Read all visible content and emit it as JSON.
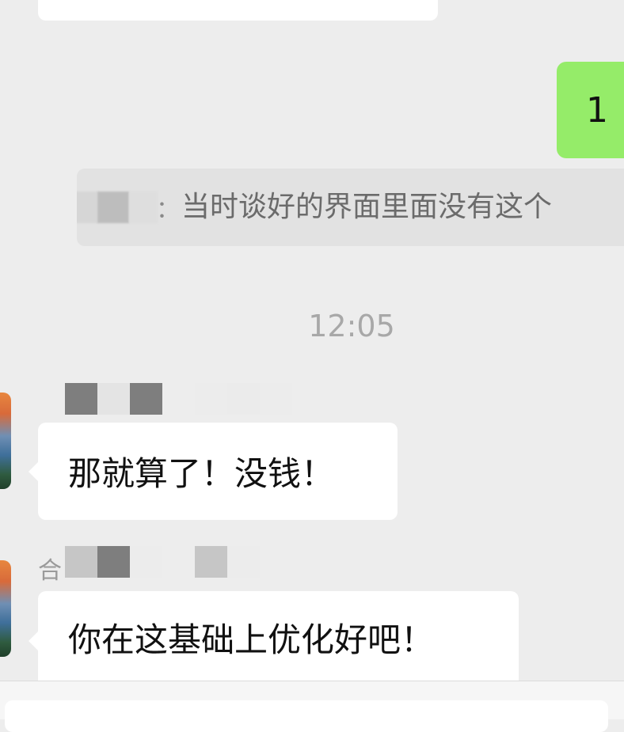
{
  "chat": {
    "outgoing_message": "1",
    "quote": {
      "separator": "：",
      "text": "当时谈好的界面里面没有这个"
    },
    "timestamp": "12:05",
    "messages": [
      {
        "text": "那就算了！没钱！"
      },
      {
        "name_prefix": "合",
        "text": "你在这基础上优化好吧！"
      }
    ]
  },
  "input": {
    "placeholder": ""
  }
}
